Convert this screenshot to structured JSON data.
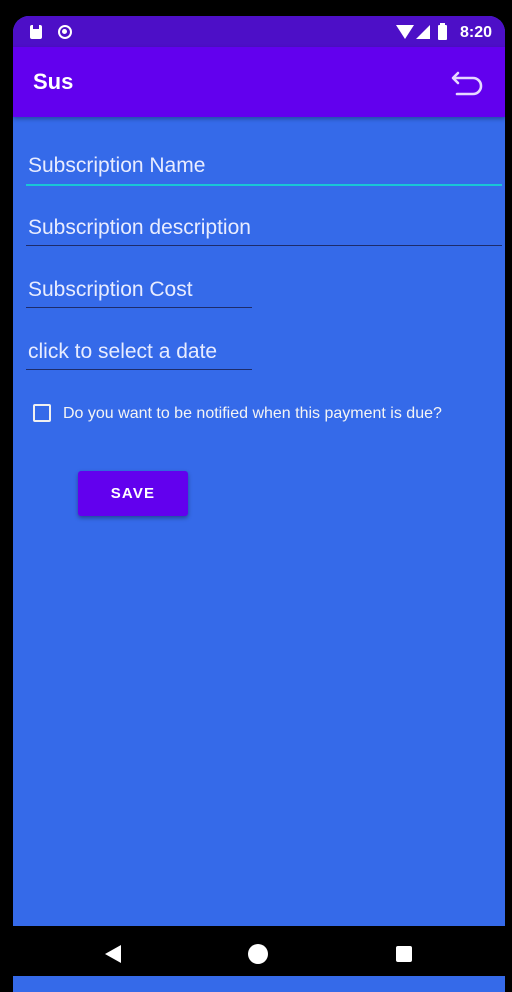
{
  "status_bar": {
    "time": "8:20",
    "icons": [
      "sd-card-icon",
      "circle-notification-icon",
      "wifi-icon",
      "signal-icon",
      "battery-icon"
    ]
  },
  "app_bar": {
    "title": "Sus",
    "action_icon": "undo-icon"
  },
  "form": {
    "name_field": {
      "placeholder": "Subscription Name",
      "focused": true
    },
    "description_field": {
      "placeholder": "Subscription description"
    },
    "cost_field": {
      "placeholder": "Subscription Cost"
    },
    "date_field": {
      "placeholder": "click to select a date"
    },
    "notify_checkbox": {
      "label": "Do you want to be notified when this payment is due?",
      "checked": false
    },
    "save_label": "SAVE"
  },
  "nav_bar": {
    "icons": [
      "back-icon",
      "home-icon",
      "recents-icon"
    ]
  },
  "colors": {
    "status_bar": "#4d0fc7",
    "app_bar": "#6200ee",
    "background": "#356ae9",
    "focus_underline": "#19c6d6",
    "button": "#6200ee"
  }
}
